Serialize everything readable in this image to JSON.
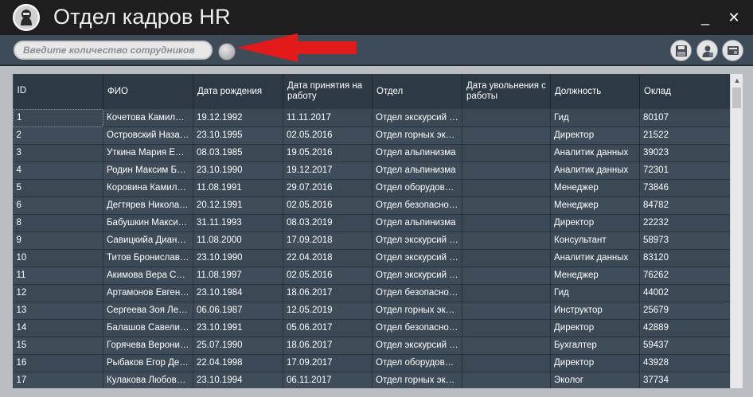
{
  "window": {
    "title": "Отдел кадров HR",
    "minimize_glyph": "_",
    "close_glyph": "✕"
  },
  "toolbar": {
    "search_placeholder": "Введите количество сотрудников",
    "icons": [
      "go-icon",
      "save-icon",
      "user-icon",
      "id-card-icon"
    ]
  },
  "colors": {
    "title_bar": "#1e1e1e",
    "toolbar": "#3e4c59",
    "grid_header": "#2d3945",
    "grid_row": "#3b4855",
    "arrow": "#e31a1a",
    "content_bg": "#babec2"
  },
  "table": {
    "columns": [
      "ID",
      "ФИО",
      "Дата рождения",
      "Дата принятия на работу",
      "Отдел",
      "Дата увольнения с работы",
      "Должность",
      "Оклад"
    ],
    "rows": [
      [
        "1",
        "Кочетова Камилла…",
        "19.12.1992",
        "11.11.2017",
        "Отдел экскурсий и…",
        "",
        "Гид",
        "80107"
      ],
      [
        "2",
        "Островский Наза…",
        "23.10.1995",
        "02.05.2016",
        "Отдел горных экс…",
        "",
        "Директор",
        "21522"
      ],
      [
        "3",
        "Уткина Мария Еф…",
        "08.03.1985",
        "19.05.2016",
        "Отдел альпинизма",
        "",
        "Аналитик данных",
        "39023"
      ],
      [
        "4",
        "Родин Максим Бо…",
        "23.10.1990",
        "19.12.2017",
        "Отдел альпинизма",
        "",
        "Аналитик данных",
        "72301"
      ],
      [
        "5",
        "Коровина Камилл…",
        "11.08.1991",
        "29.07.2016",
        "Отдел оборудования",
        "",
        "Менеджер",
        "73846"
      ],
      [
        "6",
        "Дегтярев Никола…",
        "20.12.1991",
        "02.05.2016",
        "Отдел безопасности",
        "",
        "Менеджер",
        "84782"
      ],
      [
        "8",
        "Бабушкин Максим…",
        "31.11.1993",
        "08.03.2019",
        "Отдел альпинизма",
        "",
        "Директор",
        "22232"
      ],
      [
        "9",
        "Савицкийа Диана …",
        "11.08.2000",
        "17.09.2018",
        "Отдел экскурсий и…",
        "",
        "Консультант",
        "58973"
      ],
      [
        "10",
        "Титов Бронислав …",
        "23.10.1990",
        "22.04.2018",
        "Отдел экскурсий и…",
        "",
        "Аналитик данных",
        "83120"
      ],
      [
        "11",
        "Акимова Вера Сер…",
        "11.08.1997",
        "02.05.2016",
        "Отдел экскурсий и…",
        "",
        "Менеджер",
        "76262"
      ],
      [
        "12",
        "Артамонов Евгени…",
        "23.10.1984",
        "18.06.2017",
        "Отдел безопасности",
        "",
        "Гид",
        "44002"
      ],
      [
        "13",
        "Сергеева Зоя Лео…",
        "06.06.1987",
        "12.05.2019",
        "Отдел горных экс…",
        "",
        "Инструктор",
        "25679"
      ],
      [
        "14",
        "Балашов Савелий …",
        "23.10.1991",
        "05.06.2017",
        "Отдел безопасности",
        "",
        "Директор",
        "42889"
      ],
      [
        "15",
        "Горячева Вероник…",
        "25.07.1990",
        "18.06.2017",
        "Отдел экскурсий и…",
        "",
        "Бухгалтер",
        "59437"
      ],
      [
        "16",
        "Рыбаков Егор Де…",
        "22.04.1998",
        "17.09.2017",
        "Отдел оборудования",
        "",
        "Директор",
        "43928"
      ],
      [
        "17",
        "Кулакова Любовь …",
        "23.10.1994",
        "06.11.2017",
        "Отдел горных экс…",
        "",
        "Эколог",
        "37734"
      ]
    ]
  },
  "scrollbar": {
    "up_glyph": "▲"
  }
}
